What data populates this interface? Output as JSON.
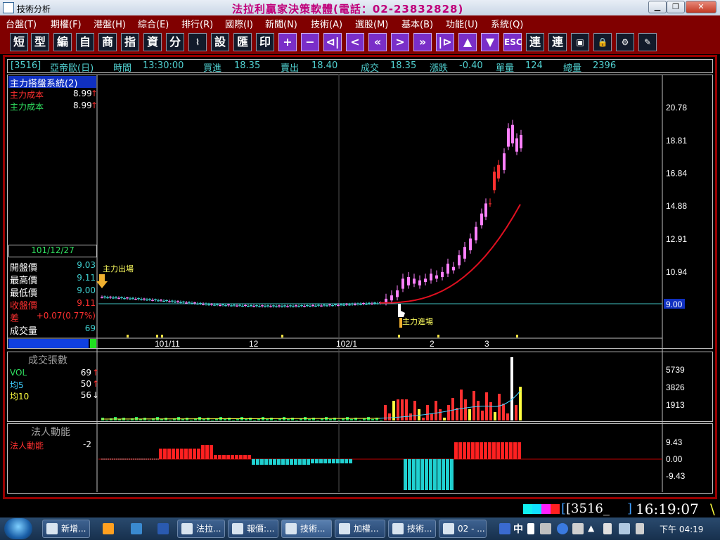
{
  "window": {
    "title": "技術分析",
    "caption": "法拉利贏家決策軟體(電話：02-23832828)"
  },
  "menu": [
    "台盤(T)",
    "期權(F)",
    "港盤(H)",
    "綜合(E)",
    "排行(R)",
    "國際(I)",
    "新聞(N)",
    "技術(A)",
    "選股(M)",
    "基本(B)",
    "功能(U)",
    "系統(Q)"
  ],
  "toolbar": {
    "buttons": [
      "短",
      "型",
      "編",
      "自",
      "商",
      "指",
      "資",
      "分",
      "chart-icon",
      "設",
      "匯",
      "印",
      "+",
      "−",
      "⊲|",
      "<",
      "«",
      ">",
      "»",
      "|⊳",
      "▲",
      "▼",
      "ESC",
      "連",
      "連",
      "window-icon",
      "lock-icon",
      "settings-icon",
      "edit-icon"
    ]
  },
  "quote": {
    "symbol": "[3516]",
    "name": "亞帝歐(日)",
    "time_label": "時間",
    "time": "13:30:00",
    "bid_label": "買進",
    "bid": "18.35",
    "ask_label": "賣出",
    "ask": "18.40",
    "trade_label": "成交",
    "trade": "18.35",
    "change_label": "漲跌",
    "change": "-0.40",
    "vol_label": "單量",
    "vol": "124",
    "total_label": "總量",
    "total": "2396"
  },
  "main_panel": {
    "indicator_title": "主力搭盤系統(2)",
    "lines": [
      {
        "label": "主力成本",
        "value": "8.99",
        "arrow": "↑",
        "color": "#ff3030"
      },
      {
        "label": "主力成本",
        "value": "8.99",
        "arrow": "↑",
        "color": "#30e060"
      }
    ],
    "date": "101/12/27",
    "ohlc": [
      {
        "label": "開盤價",
        "value": "9.03",
        "lc": "#ffffff",
        "vc": "#40d0d0"
      },
      {
        "label": "最高價",
        "value": "9.11",
        "lc": "#ffffff",
        "vc": "#40d0d0"
      },
      {
        "label": "最低價",
        "value": "9.00",
        "lc": "#ffffff",
        "vc": "#40d0d0"
      },
      {
        "label": "收盤價",
        "value": "9.11",
        "lc": "#ff3030",
        "vc": "#ff3030"
      },
      {
        "label": "差",
        "value": "+0.07(0.77%)",
        "lc": "#ff3030",
        "vc": "#ff3030"
      },
      {
        "label": "成交量",
        "value": "69",
        "lc": "#ffffff",
        "vc": "#40d0d0"
      }
    ],
    "y_ticks": [
      "20.78",
      "18.81",
      "16.84",
      "14.88",
      "12.91",
      "10.94",
      "9.00"
    ],
    "x_ticks": [
      "101/11",
      "12",
      "102/1",
      "2",
      "3"
    ],
    "annotations": {
      "exit": "主力出場",
      "entry": "主力進場"
    }
  },
  "volume_panel": {
    "title": "成交張數",
    "lines": [
      {
        "label": "VOL",
        "value": "69",
        "arrow": "↑",
        "color": "#30e060"
      },
      {
        "label": "均5",
        "value": "50",
        "arrow": "↑",
        "color": "#40d0ff"
      },
      {
        "label": "均10",
        "value": "56",
        "arrow": "↓",
        "color": "#ffff40"
      }
    ],
    "y_ticks": [
      "5739",
      "3826",
      "1913"
    ]
  },
  "inst_panel": {
    "title": "法人動能",
    "lines": [
      {
        "label": "法人動能",
        "value": "-2",
        "color": "#ff3030"
      }
    ],
    "y_ticks": [
      "9.43",
      "0.00",
      "-9.43"
    ]
  },
  "status": {
    "code": "[3516_",
    "code_close": "]",
    "clock": "16:19:07",
    "tail": "\\"
  },
  "taskbar": {
    "items": [
      "新增...",
      "法拉...",
      "報價:...",
      "技術...",
      "加權...",
      "技術...",
      "02 - ..."
    ],
    "clock": "下午 04:19",
    "ime": "中"
  }
}
